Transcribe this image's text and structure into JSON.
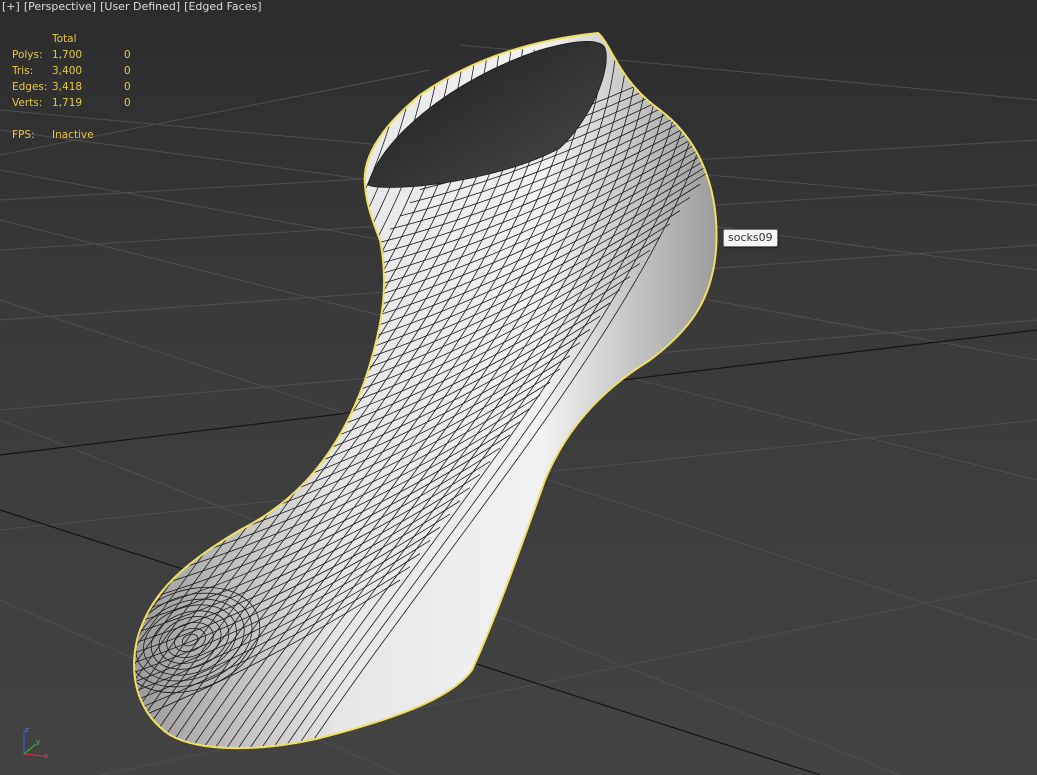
{
  "viewport": {
    "labels": [
      "[+]",
      "[Perspective]",
      "[User Defined]",
      "[Edged Faces]"
    ]
  },
  "stats": {
    "header": "Total",
    "rows": [
      {
        "label": "Polys:",
        "total": "1,700",
        "selected": "0"
      },
      {
        "label": "Tris:",
        "total": "3,400",
        "selected": "0"
      },
      {
        "label": "Edges:",
        "total": "3,418",
        "selected": "0"
      },
      {
        "label": "Verts:",
        "total": "1,719",
        "selected": "0"
      }
    ],
    "fps_label": "FPS:",
    "fps_value": "Inactive"
  },
  "object": {
    "name": "socks09"
  },
  "axis_gizmo": {
    "icon": "xyz-axis-tripod-icon"
  },
  "colors": {
    "stats_text": "#e7c742",
    "selection_outline": "#f0e060",
    "background_top": "#2c2c2c",
    "background_bottom": "#434343",
    "grid_line": "#4d4d4d",
    "grid_main_line": "#151515",
    "mesh_fill": "#e8e8e8",
    "mesh_wire": "#1a1a1a"
  }
}
